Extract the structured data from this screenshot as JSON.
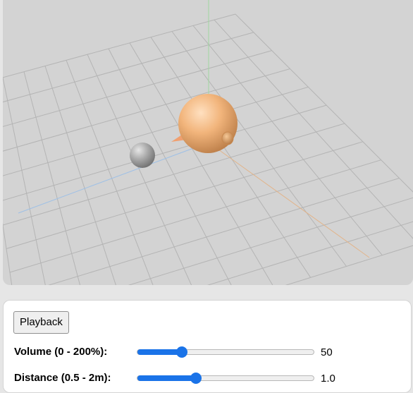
{
  "playback_button": "Playback",
  "volume": {
    "label": "Volume (0 - 200%):",
    "value": "50",
    "fraction": 0.25
  },
  "distance": {
    "label": "Distance (0.5 - 2m):",
    "value": "1.0",
    "fraction": 0.333
  },
  "colors": {
    "scene_background": "#d3d3d3",
    "grid_line": "#b4b4b4",
    "axis_x": "#e2b48a",
    "axis_y": "#9fd79f",
    "axis_z": "#9ec0e6",
    "head_sphere": "#f0b47c",
    "listener_sphere": "#a0a0a0",
    "slider_accent": "#1a73e8"
  }
}
